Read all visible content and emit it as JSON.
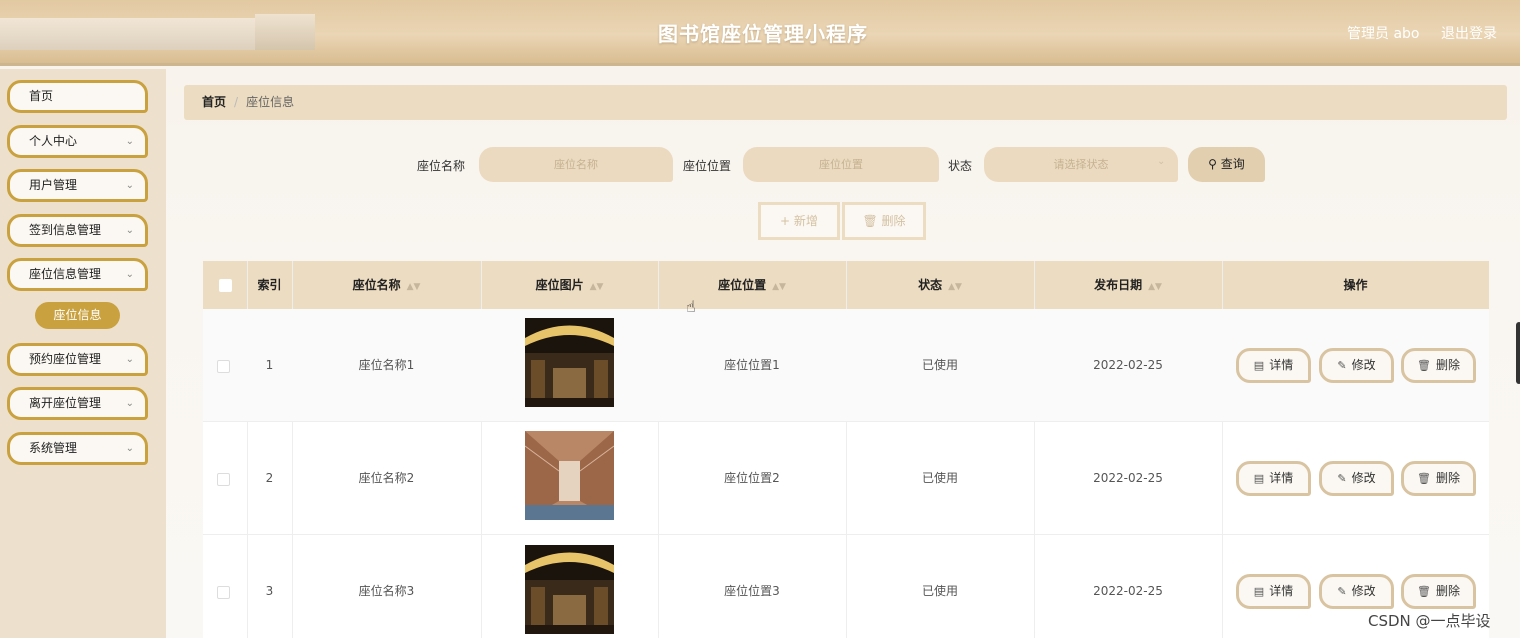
{
  "header": {
    "title": "图书馆座位管理小程序",
    "admin_label": "管理员 abo",
    "logout_label": "退出登录"
  },
  "sidebar": {
    "items": [
      {
        "label": "首页",
        "has_chevron": false
      },
      {
        "label": "个人中心",
        "has_chevron": true
      },
      {
        "label": "用户管理",
        "has_chevron": true
      },
      {
        "label": "签到信息管理",
        "has_chevron": true
      },
      {
        "label": "座位信息管理",
        "has_chevron": true
      },
      {
        "label": "预约座位管理",
        "has_chevron": true
      },
      {
        "label": "离开座位管理",
        "has_chevron": true
      },
      {
        "label": "系统管理",
        "has_chevron": true
      }
    ],
    "active_sub": "座位信息"
  },
  "breadcrumb": {
    "home": "首页",
    "separator": "/",
    "current": "座位信息"
  },
  "search": {
    "name_label": "座位名称",
    "name_placeholder": "座位名称",
    "location_label": "座位位置",
    "location_placeholder": "座位位置",
    "status_label": "状态",
    "status_placeholder": "请选择状态",
    "query_label": "查询"
  },
  "actions": {
    "add_label": "新增",
    "delete_label": "删除"
  },
  "table": {
    "headers": [
      "索引",
      "座位名称",
      "座位图片",
      "座位位置",
      "状态",
      "发布日期",
      "操作"
    ],
    "rows": [
      {
        "index": "1",
        "name": "座位名称1",
        "image": "library-hall-dark",
        "location": "座位位置1",
        "status": "已使用",
        "date": "2022-02-25"
      },
      {
        "index": "2",
        "name": "座位名称2",
        "image": "library-corridor-red",
        "location": "座位位置2",
        "status": "已使用",
        "date": "2022-02-25"
      },
      {
        "index": "3",
        "name": "座位名称3",
        "image": "library-hall-dark",
        "location": "座位位置3",
        "status": "已使用",
        "date": "2022-02-25"
      }
    ],
    "row_actions": {
      "detail": "详情",
      "edit": "修改",
      "delete": "删除"
    }
  },
  "watermark": "CSDN @一点毕设",
  "colors": {
    "accent": "#c9a13e",
    "header_bg": "#e2c9a2",
    "table_head_bg": "#ecdcc1",
    "sidebar_bg": "#ede1cd"
  }
}
